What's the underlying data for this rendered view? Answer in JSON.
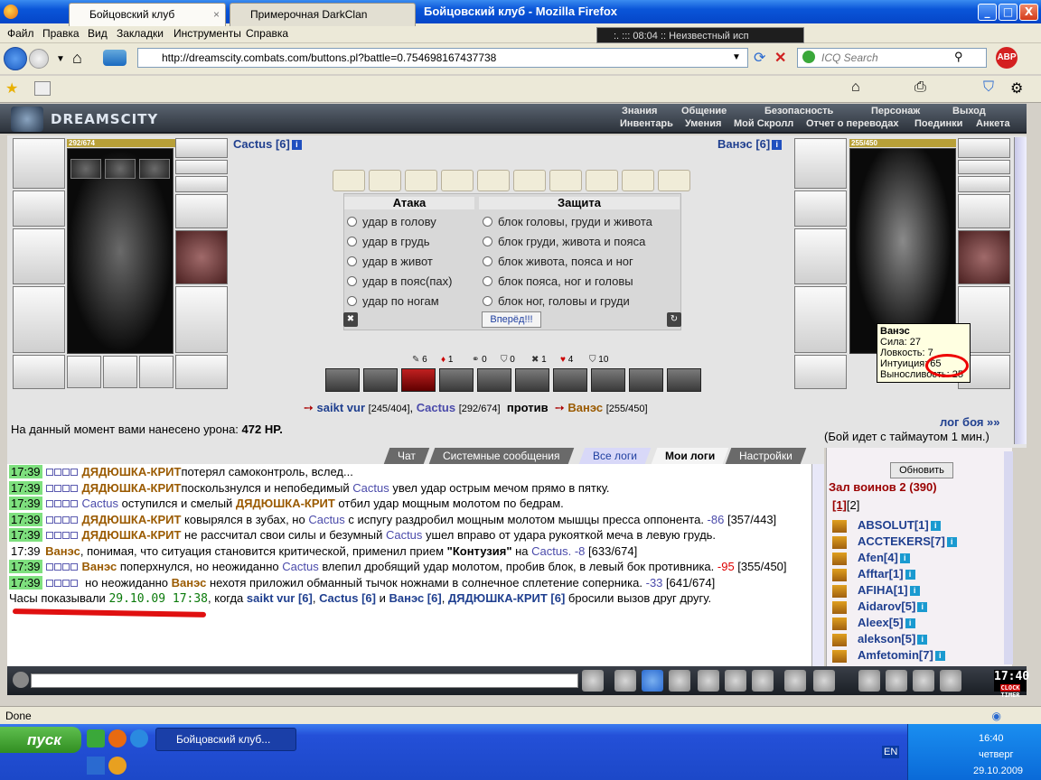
{
  "window": {
    "title": "Бойцовский клуб - Mozilla Firefox",
    "min": "_",
    "max": "□",
    "close": "X"
  },
  "menu": [
    "Файл",
    "Правка",
    "Вид",
    "Закладки",
    "Инструменты",
    "Справка"
  ],
  "now_playing": ":.           ::: 08:04 :: Неизвестный исп",
  "url": "http://dreamscity.combats.com/buttons.pl?battle=0.754698167437738",
  "search_placeholder": "ICQ Search",
  "tabs": [
    "Бойцовский клуб",
    "Примерочная DarkClan"
  ],
  "game": {
    "logo": "DREAMSCITY",
    "menu_top": [
      "Знания",
      "Общение",
      "Безопасность",
      "Персонаж",
      "Выход"
    ],
    "menu_bottom": [
      "Инвентарь",
      "Умения",
      "Мой Скролл",
      "Отчет о переводах",
      "Поединки",
      "Анкета"
    ]
  },
  "player": {
    "name": "Cactus [6]",
    "hp": "292/674",
    "hp_fraction": 0.433
  },
  "enemy": {
    "name": "Ванэс [6]",
    "hp": "255/450",
    "hp_fraction": 0.567
  },
  "attack": {
    "title": "Атака",
    "options": [
      "удар в голову",
      "удар в грудь",
      "удар в живот",
      "удар в пояс(пах)",
      "удар по ногам"
    ]
  },
  "defense": {
    "title": "Защита",
    "options": [
      "блок головы, груди и живота",
      "блок груди, живота и пояса",
      "блок живота, пояса и ног",
      "блок пояса, ног и головы",
      "блок ног, головы и груди"
    ]
  },
  "forward": "Вперёд!!!",
  "counters": [
    "6",
    "1",
    "0",
    "0",
    "1",
    "4",
    "10"
  ],
  "teams": {
    "a1": "saikt vur",
    "a1hp": "[245/404]",
    "a2": "Cactus",
    "a2hp": "[292/674]",
    "vs": "против",
    "b1": "Ванэс",
    "b1hp": "[255/450]"
  },
  "damage_text": "На данный момент вами нанесено урона:",
  "damage_value": "472 HP.",
  "log_link": "лог боя »»",
  "timeout": "(Бой идет с таймаутом 1 мин.)",
  "tooltip": {
    "name": "Ванэс",
    "l1": "Сила: 27",
    "l2": "Ловкость: 7",
    "l3": "Интуиция: 65",
    "l4": "Выносливость: 25"
  },
  "chat_tabs": [
    "Чат",
    "Системные сообщения",
    "Все логи",
    "Мои логи",
    "Настройки"
  ],
  "chat": [
    {
      "ts": "17:39",
      "parts": [
        [
          "b",
          "ДЯДЮШКА-КРИТ"
        ],
        [
          "",
          "потерял самоконтроль, вслед..."
        ]
      ]
    },
    {
      "ts": "17:39",
      "parts": [
        [
          "b",
          "ДЯДЮШКА-КРИТ"
        ],
        [
          "",
          "поскользнулся и непобедимый "
        ],
        [
          "c",
          "Cactus"
        ],
        [
          "",
          " увел удар острым мечом прямо в пятку."
        ]
      ]
    },
    {
      "ts": "17:39",
      "parts": [
        [
          "c",
          "Cactus"
        ],
        [
          "",
          " оступился и смелый "
        ],
        [
          "b",
          "ДЯДЮШКА-КРИТ"
        ],
        [
          "",
          " отбил удар мощным молотом по бедрам."
        ]
      ]
    },
    {
      "ts": "17:39",
      "parts": [
        [
          "b",
          "ДЯДЮШКА-КРИТ"
        ],
        [
          "",
          " ковырялся в зубах, но "
        ],
        [
          "c",
          "Cactus"
        ],
        [
          "",
          " с испугу раздробил мощным молотом мышцы пресса оппонента. "
        ],
        [
          "c",
          "-86"
        ],
        [
          "",
          " [357/443]"
        ]
      ]
    },
    {
      "ts": "17:39",
      "parts": [
        [
          "b",
          "ДЯДЮШКА-КРИТ"
        ],
        [
          "",
          " не рассчитал свои силы и безумный "
        ],
        [
          "c",
          "Cactus"
        ],
        [
          "",
          " ушел вправо от удара рукояткой меча в левую грудь."
        ]
      ]
    },
    {
      "ts": "17:39",
      "plain": true,
      "parts": [
        [
          "v",
          "Ванэс"
        ],
        [
          "",
          ", понимая, что ситуация становится критической, применил прием "
        ],
        [
          "k",
          "\"Контузия\""
        ],
        [
          "",
          " на "
        ],
        [
          "c",
          "Cactus"
        ],
        [
          "c",
          ". -8"
        ],
        [
          "",
          " [633/674]"
        ]
      ]
    },
    {
      "ts": "17:39",
      "parts": [
        [
          "v",
          "Ванэс"
        ],
        [
          "",
          " поперхнулся, но неожиданно "
        ],
        [
          "c",
          "Cactus"
        ],
        [
          "",
          " влепил дробящий удар молотом, пробив блок, в левый бок противника. "
        ],
        [
          "red",
          "-95"
        ],
        [
          "",
          " [355/450]"
        ]
      ]
    },
    {
      "ts": "17:39",
      "parts": [
        [
          "",
          ""
        ],
        [
          "",
          " но неожиданно "
        ],
        [
          "v",
          "Ванэс"
        ],
        [
          "",
          " нехотя приложил обманный тычок ножнами в солнечное сплетение соперника. "
        ],
        [
          "c",
          "-33"
        ],
        [
          "",
          " [641/674]"
        ]
      ]
    },
    {
      "ts": "",
      "plain": true,
      "parts": [
        [
          "",
          "Часы показывали "
        ],
        [
          "g",
          "29.10.09 17:38"
        ],
        [
          "",
          ", когда "
        ],
        [
          "blue",
          "saikt vur [6]"
        ],
        [
          "",
          ", "
        ],
        [
          "blue",
          "Cactus [6]"
        ],
        [
          "",
          " и "
        ],
        [
          "blue",
          "Ванэс [6]"
        ],
        [
          "",
          ", "
        ],
        [
          "blue",
          "ДЯДЮШКА-КРИТ [6]"
        ],
        [
          "",
          " бросили вызов друг другу."
        ]
      ]
    }
  ],
  "refresh": "Обновить",
  "hall": "Зал воинов 2 (390)",
  "pages": [
    "[1]",
    "[2]"
  ],
  "roster": [
    "ABSOLUT[1]",
    "ACCTEKERS[7]",
    "Afen[4]",
    "Afftar[1]",
    "AFIHA[1]",
    "Aidarov[5]",
    "Aleex[5]",
    "alekson[5]",
    "Amfetomin[7]"
  ],
  "clock": "17:40",
  "clock_labels": [
    "CLOCK",
    "TIMER"
  ],
  "status": "Done",
  "taskbar": {
    "start": "пуск",
    "item": "Бойцовский клуб...",
    "time": "16:40",
    "day": "четверг",
    "date": "29.10.2009",
    "lang": "EN"
  }
}
